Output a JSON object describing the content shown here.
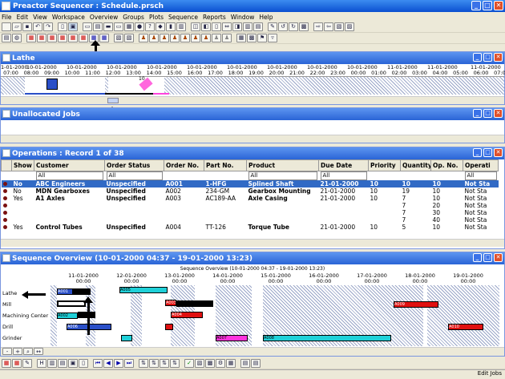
{
  "window": {
    "title": "Preactor Sequencer : Schedule.prsch"
  },
  "menu": [
    "File",
    "Edit",
    "View",
    "Workspace",
    "Overview",
    "Groups",
    "Plots",
    "Sequence",
    "Reports",
    "Window",
    "Help"
  ],
  "lathe": {
    "title": "Lathe",
    "dates": [
      "1-01-2000",
      "10-01-2000",
      "10-01-2000",
      "10-01-2000",
      "10-01-2000",
      "10-01-2000",
      "10-01-2000",
      "10-01-2000",
      "10-01-2000",
      "10-01-2000",
      "11-01-2000",
      "11-01-2000",
      "11-01-2000"
    ],
    "times": [
      "07:00",
      "08:00",
      "09:00",
      "10:00",
      "11:00",
      "12:00",
      "13:00",
      "14:00",
      "15:00",
      "16:00",
      "17:00",
      "18:00",
      "19:00",
      "20:00",
      "21:00",
      "22:00",
      "23:00",
      "00:00",
      "01:00",
      "02:00",
      "03:00",
      "04:00",
      "05:00",
      "06:00",
      "07:00"
    ],
    "marker": "10"
  },
  "unallocated": {
    "title": "Unallocated Jobs"
  },
  "operations": {
    "title": "Operations : Record 1 of 38",
    "columns": [
      "Show",
      "Customer",
      "Order Status",
      "Order No.",
      "Part No.",
      "Product",
      "Due Date",
      "Priority",
      "Quantity",
      "Op. No.",
      "Operati"
    ],
    "filters": [
      "All",
      "All",
      "All",
      "All",
      "All"
    ],
    "rows": [
      [
        "No",
        "ABC Engineers",
        "Unspecified",
        "A001",
        "1-HFG",
        "Splined Shaft",
        "21-01-2000",
        "10",
        "10",
        "10",
        "Not Sta"
      ],
      [
        "No",
        "MDN Gearboxes",
        "Unspecified",
        "A002",
        "234-GM",
        "Gearbox Mounting",
        "21-01-2000",
        "10",
        "19",
        "10",
        "Not Sta"
      ],
      [
        "Yes",
        "A1 Axles",
        "Unspecified",
        "A003",
        "AC189-AA",
        "Axle Casing",
        "21-01-2000",
        "10",
        "7",
        "10",
        "Not Sta"
      ],
      [
        "",
        "",
        "",
        "",
        "",
        "",
        "",
        "",
        "7",
        "20",
        "Not Sta"
      ],
      [
        "",
        "",
        "",
        "",
        "",
        "",
        "",
        "",
        "7",
        "30",
        "Not Sta"
      ],
      [
        "",
        "",
        "",
        "",
        "",
        "",
        "",
        "",
        "7",
        "40",
        "Not Sta"
      ],
      [
        "Yes",
        "Control Tubes",
        "Unspecified",
        "A004",
        "TT-126",
        "Torque Tube",
        "21-01-2000",
        "10",
        "5",
        "10",
        "Not Sta"
      ]
    ]
  },
  "sequence": {
    "title": "Sequence Overview   (10-01-2000 04:37 - 19-01-2000 13:23)",
    "subtitle": "Sequence Overview   (10-01-2000 04:37 - 19-01-2000 13:23)",
    "dates": [
      "11-01-2000",
      "12-01-2000",
      "13-01-2000",
      "14-01-2000",
      "15-01-2000",
      "16-01-2000",
      "17-01-2000",
      "18-01-2000",
      "19-01-2000"
    ],
    "time": "00:00",
    "resources": [
      "Lathe",
      "Mill",
      "Machining Center",
      "Drill",
      "Grinder"
    ],
    "jobs": [
      "A001",
      "A005",
      "A002",
      "A003",
      "A004",
      "A006",
      "A007",
      "A008",
      "A009",
      "A010"
    ]
  },
  "status": {
    "text": "Edit Jobs"
  }
}
